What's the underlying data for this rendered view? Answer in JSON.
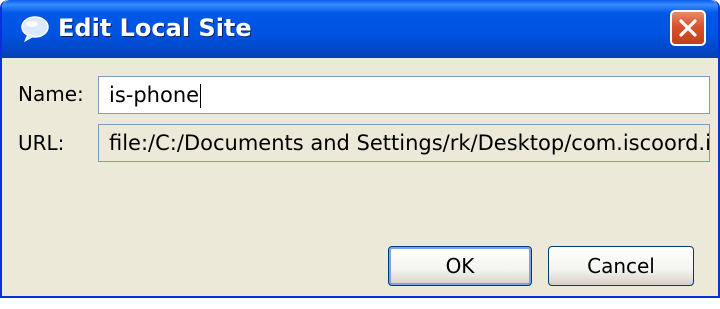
{
  "window": {
    "title": "Edit Local Site",
    "title_icon": "speech-bubble-icon",
    "close_icon": "close-icon"
  },
  "form": {
    "name_label": "Name:",
    "name_value": "is-phone",
    "url_label": "URL:",
    "url_value": "file:/C:/Documents and Settings/rk/Desktop/com.iscoord.isph"
  },
  "buttons": {
    "ok_label": "OK",
    "cancel_label": "Cancel"
  },
  "colors": {
    "titlebar": "#0053e1",
    "close_button": "#d8532c",
    "dialog_background": "#ece9d8",
    "field_border": "#7f9db9"
  }
}
